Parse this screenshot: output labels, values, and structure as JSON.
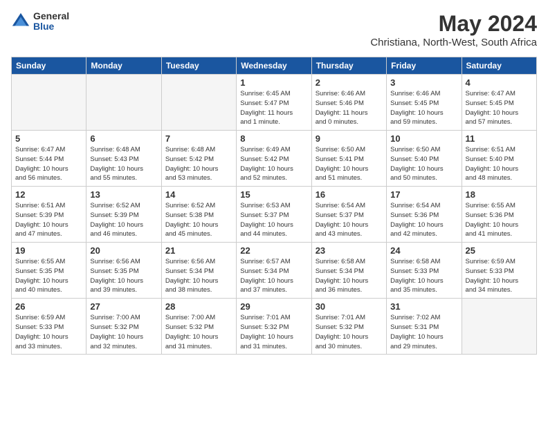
{
  "header": {
    "logo_general": "General",
    "logo_blue": "Blue",
    "month_title": "May 2024",
    "location": "Christiana, North-West, South Africa"
  },
  "weekdays": [
    "Sunday",
    "Monday",
    "Tuesday",
    "Wednesday",
    "Thursday",
    "Friday",
    "Saturday"
  ],
  "weeks": [
    [
      {
        "day": "",
        "info": ""
      },
      {
        "day": "",
        "info": ""
      },
      {
        "day": "",
        "info": ""
      },
      {
        "day": "1",
        "info": "Sunrise: 6:45 AM\nSunset: 5:47 PM\nDaylight: 11 hours\nand 1 minute."
      },
      {
        "day": "2",
        "info": "Sunrise: 6:46 AM\nSunset: 5:46 PM\nDaylight: 11 hours\nand 0 minutes."
      },
      {
        "day": "3",
        "info": "Sunrise: 6:46 AM\nSunset: 5:45 PM\nDaylight: 10 hours\nand 59 minutes."
      },
      {
        "day": "4",
        "info": "Sunrise: 6:47 AM\nSunset: 5:45 PM\nDaylight: 10 hours\nand 57 minutes."
      }
    ],
    [
      {
        "day": "5",
        "info": "Sunrise: 6:47 AM\nSunset: 5:44 PM\nDaylight: 10 hours\nand 56 minutes."
      },
      {
        "day": "6",
        "info": "Sunrise: 6:48 AM\nSunset: 5:43 PM\nDaylight: 10 hours\nand 55 minutes."
      },
      {
        "day": "7",
        "info": "Sunrise: 6:48 AM\nSunset: 5:42 PM\nDaylight: 10 hours\nand 53 minutes."
      },
      {
        "day": "8",
        "info": "Sunrise: 6:49 AM\nSunset: 5:42 PM\nDaylight: 10 hours\nand 52 minutes."
      },
      {
        "day": "9",
        "info": "Sunrise: 6:50 AM\nSunset: 5:41 PM\nDaylight: 10 hours\nand 51 minutes."
      },
      {
        "day": "10",
        "info": "Sunrise: 6:50 AM\nSunset: 5:40 PM\nDaylight: 10 hours\nand 50 minutes."
      },
      {
        "day": "11",
        "info": "Sunrise: 6:51 AM\nSunset: 5:40 PM\nDaylight: 10 hours\nand 48 minutes."
      }
    ],
    [
      {
        "day": "12",
        "info": "Sunrise: 6:51 AM\nSunset: 5:39 PM\nDaylight: 10 hours\nand 47 minutes."
      },
      {
        "day": "13",
        "info": "Sunrise: 6:52 AM\nSunset: 5:39 PM\nDaylight: 10 hours\nand 46 minutes."
      },
      {
        "day": "14",
        "info": "Sunrise: 6:52 AM\nSunset: 5:38 PM\nDaylight: 10 hours\nand 45 minutes."
      },
      {
        "day": "15",
        "info": "Sunrise: 6:53 AM\nSunset: 5:37 PM\nDaylight: 10 hours\nand 44 minutes."
      },
      {
        "day": "16",
        "info": "Sunrise: 6:54 AM\nSunset: 5:37 PM\nDaylight: 10 hours\nand 43 minutes."
      },
      {
        "day": "17",
        "info": "Sunrise: 6:54 AM\nSunset: 5:36 PM\nDaylight: 10 hours\nand 42 minutes."
      },
      {
        "day": "18",
        "info": "Sunrise: 6:55 AM\nSunset: 5:36 PM\nDaylight: 10 hours\nand 41 minutes."
      }
    ],
    [
      {
        "day": "19",
        "info": "Sunrise: 6:55 AM\nSunset: 5:35 PM\nDaylight: 10 hours\nand 40 minutes."
      },
      {
        "day": "20",
        "info": "Sunrise: 6:56 AM\nSunset: 5:35 PM\nDaylight: 10 hours\nand 39 minutes."
      },
      {
        "day": "21",
        "info": "Sunrise: 6:56 AM\nSunset: 5:34 PM\nDaylight: 10 hours\nand 38 minutes."
      },
      {
        "day": "22",
        "info": "Sunrise: 6:57 AM\nSunset: 5:34 PM\nDaylight: 10 hours\nand 37 minutes."
      },
      {
        "day": "23",
        "info": "Sunrise: 6:58 AM\nSunset: 5:34 PM\nDaylight: 10 hours\nand 36 minutes."
      },
      {
        "day": "24",
        "info": "Sunrise: 6:58 AM\nSunset: 5:33 PM\nDaylight: 10 hours\nand 35 minutes."
      },
      {
        "day": "25",
        "info": "Sunrise: 6:59 AM\nSunset: 5:33 PM\nDaylight: 10 hours\nand 34 minutes."
      }
    ],
    [
      {
        "day": "26",
        "info": "Sunrise: 6:59 AM\nSunset: 5:33 PM\nDaylight: 10 hours\nand 33 minutes."
      },
      {
        "day": "27",
        "info": "Sunrise: 7:00 AM\nSunset: 5:32 PM\nDaylight: 10 hours\nand 32 minutes."
      },
      {
        "day": "28",
        "info": "Sunrise: 7:00 AM\nSunset: 5:32 PM\nDaylight: 10 hours\nand 31 minutes."
      },
      {
        "day": "29",
        "info": "Sunrise: 7:01 AM\nSunset: 5:32 PM\nDaylight: 10 hours\nand 31 minutes."
      },
      {
        "day": "30",
        "info": "Sunrise: 7:01 AM\nSunset: 5:32 PM\nDaylight: 10 hours\nand 30 minutes."
      },
      {
        "day": "31",
        "info": "Sunrise: 7:02 AM\nSunset: 5:31 PM\nDaylight: 10 hours\nand 29 minutes."
      },
      {
        "day": "",
        "info": ""
      }
    ]
  ]
}
